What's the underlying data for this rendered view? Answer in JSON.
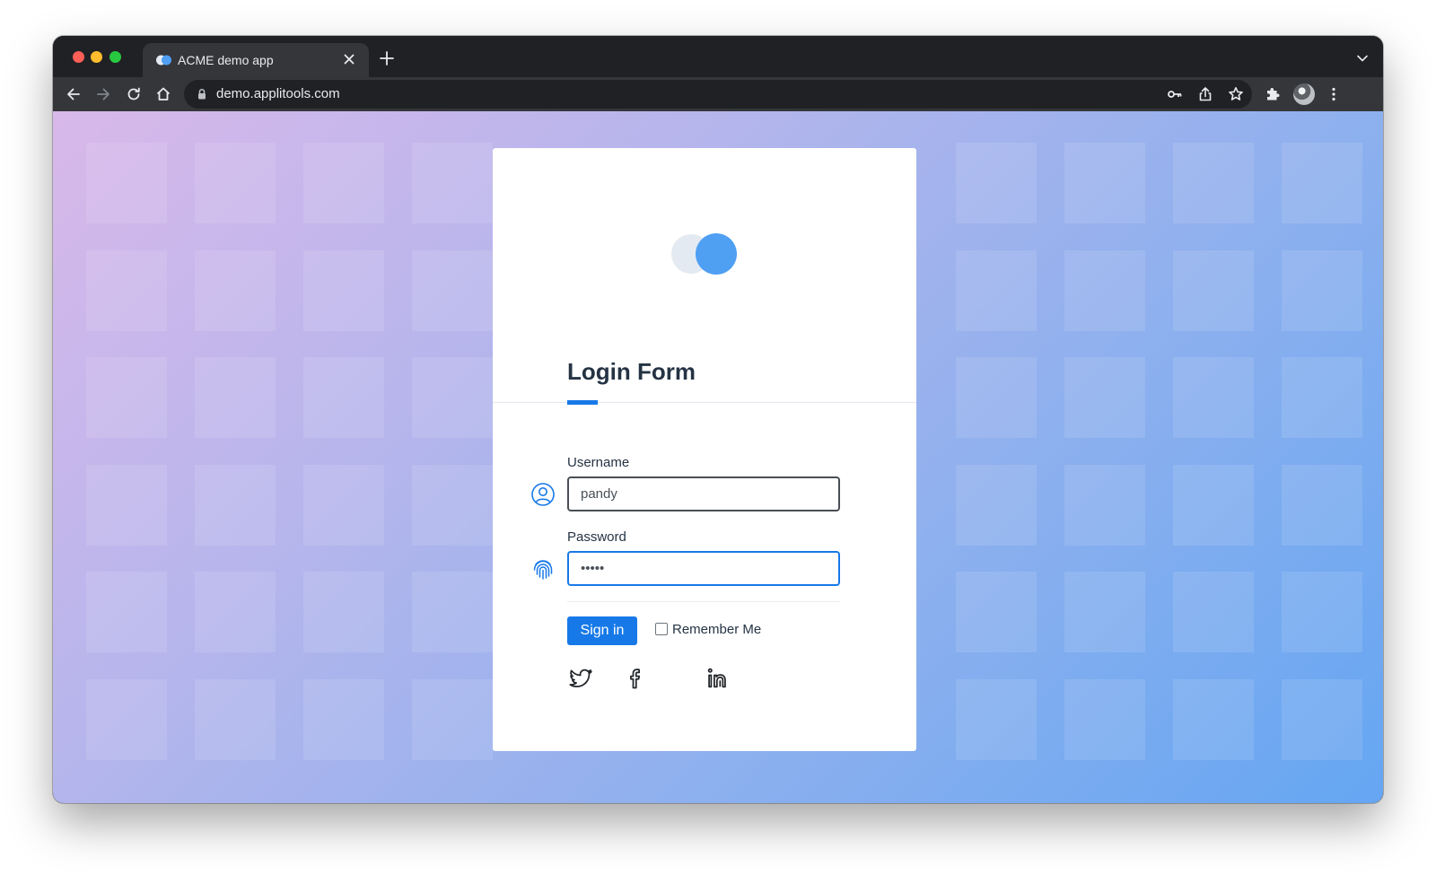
{
  "browser": {
    "tab_title": "ACME demo app",
    "url": "demo.applitools.com"
  },
  "login": {
    "title": "Login Form",
    "username_label": "Username",
    "username_value": "pandy",
    "password_label": "Password",
    "password_value": "•••••",
    "signin_label": "Sign in",
    "remember_label": "Remember Me",
    "remember_checked": false
  },
  "icons": {
    "username": "user-circle-icon",
    "password": "fingerprint-icon",
    "social": [
      "twitter-icon",
      "facebook-icon",
      "linkedin-icon"
    ]
  },
  "colors": {
    "accent": "#1779e8",
    "logo_primary": "#4f9ff3",
    "logo_secondary": "#e4eaf2",
    "heading": "#253344"
  }
}
